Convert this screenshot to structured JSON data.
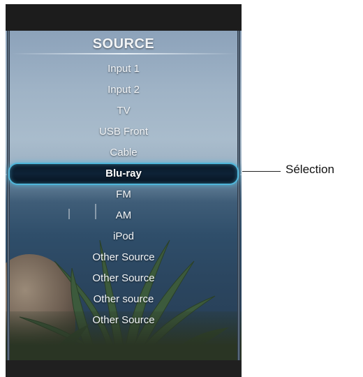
{
  "menu": {
    "title": "SOURCE",
    "items": [
      {
        "label": "Input 1"
      },
      {
        "label": "Input 2"
      },
      {
        "label": "TV"
      },
      {
        "label": "USB Front"
      },
      {
        "label": "Cable"
      },
      {
        "label": "Blu-ray",
        "selected": true
      },
      {
        "label": "FM"
      },
      {
        "label": "AM"
      },
      {
        "label": "iPod"
      },
      {
        "label": "Other Source"
      },
      {
        "label": "Other Source"
      },
      {
        "label": "Other source"
      },
      {
        "label": "Other Source"
      }
    ]
  },
  "annotation": {
    "label": "Sélection"
  },
  "colors": {
    "selection_glow": "#4fb6da",
    "screen_frame": "#1c1c1c"
  }
}
